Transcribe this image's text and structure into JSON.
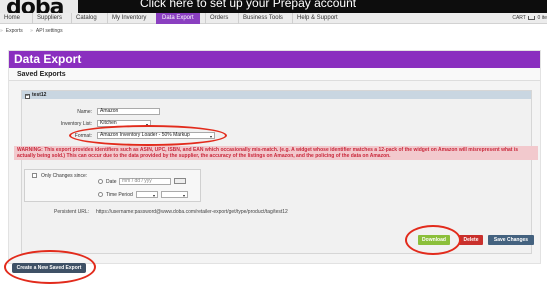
{
  "header": {
    "logo": "doba",
    "promo": "Click here to set up your Prepay account",
    "nav": [
      "Home",
      "Suppliers",
      "Catalog",
      "My Inventory",
      "Data Export",
      "Orders",
      "Business Tools",
      "Help & Support"
    ],
    "active_nav": "Data Export",
    "cart_label": "CART",
    "cart_count": "0 ite"
  },
  "subnav": [
    "Exports",
    "API settings"
  ],
  "page": {
    "title": "Data Export",
    "subtitle": "Saved Exports"
  },
  "export": {
    "section_name": "test12",
    "name_label": "Name:",
    "name_value": "Amazon",
    "inventory_label": "Inventory List:",
    "inventory_value": "Kitchen",
    "format_label": "Format:",
    "format_value": "Amazon Inventory Loader - 50% Markup",
    "warning": "WARNING: This export provides identifiers such as ASIN, UPC, ISBN, and EAN which occasionally mis-match. (e.g. A widget whose identifier matches a 12-pack of the widget on Amazon will misrepresent what is actually being sold.) This can occur due to the data provided by the supplier, the accuracy of the listings on Amazon, and the policing of the data on Amazon.",
    "only_changes_label": "Only Changes since:",
    "date_label": "Date",
    "date_placeholder": "mm / dd / yyy",
    "time_period_label": "Time Period",
    "persistent_url_label": "Persistent URL:",
    "persistent_url_value": "https://username:password@www.doba.com/retailer-export/get/type/product/tag/test12"
  },
  "buttons": {
    "download": "Download",
    "delete": "Delete",
    "save": "Save Changes",
    "create": "Create a New Saved Export"
  },
  "colors": {
    "accent_purple": "#8a2fbf",
    "download_green": "#8bbf3a",
    "delete_red": "#c9302c",
    "save_blue": "#44627f",
    "highlight_ring": "#e22b1c"
  }
}
